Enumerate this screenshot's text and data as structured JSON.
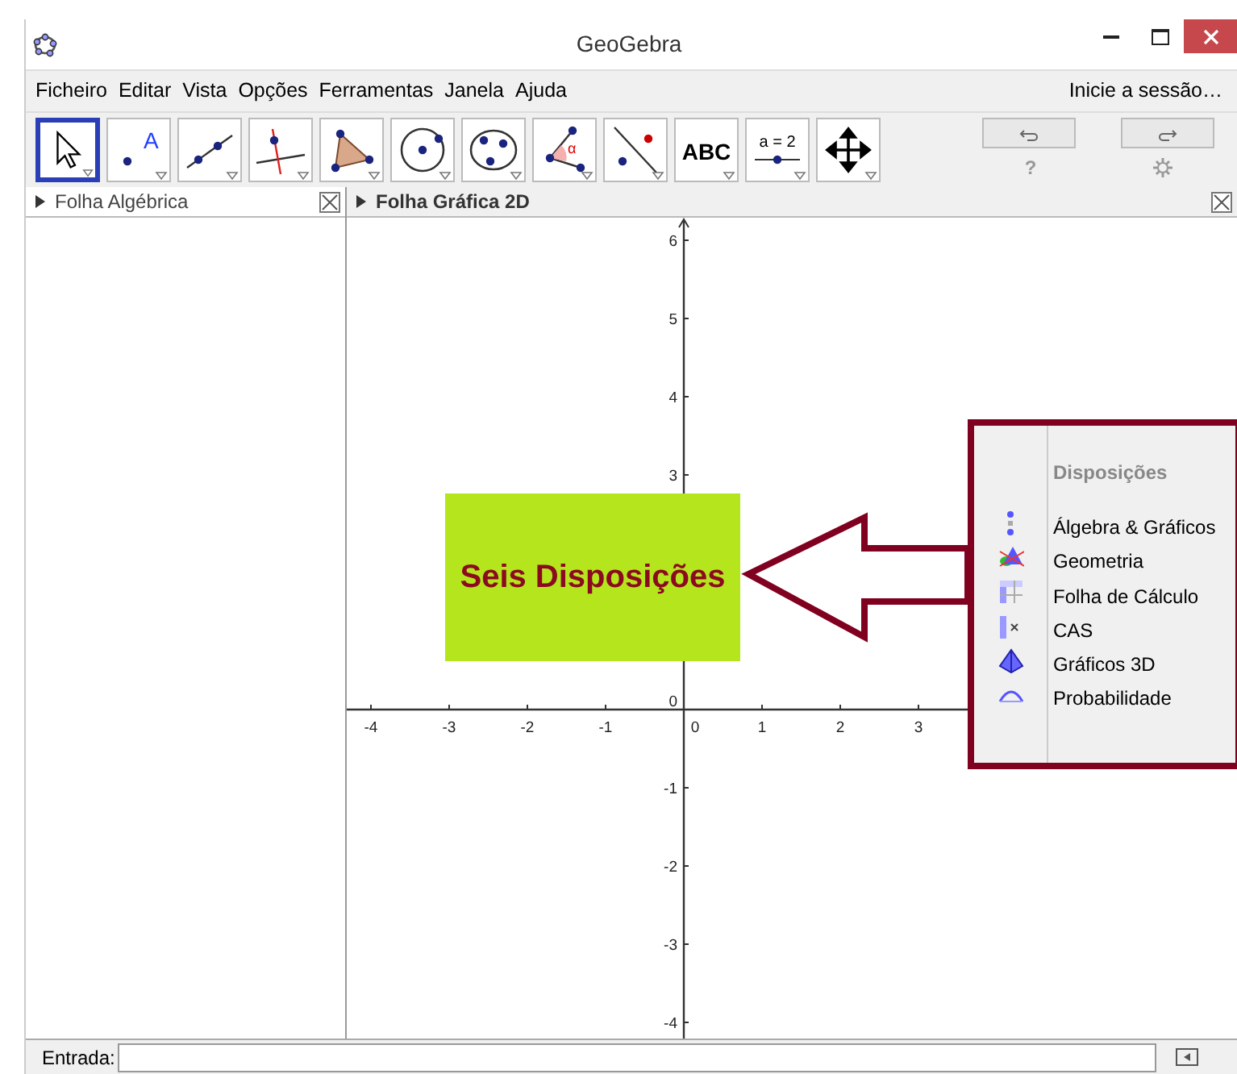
{
  "window": {
    "title": "GeoGebra"
  },
  "menu": [
    "Ficheiro",
    "Editar",
    "Vista",
    "Opções",
    "Ferramentas",
    "Janela",
    "Ajuda"
  ],
  "login": "Inicie a sessão…",
  "toolbar": [
    {
      "kind": "move",
      "selected": true
    },
    {
      "kind": "point",
      "label": "A",
      "selected": false
    },
    {
      "kind": "line",
      "selected": false
    },
    {
      "kind": "perpendicular",
      "selected": false
    },
    {
      "kind": "polygon",
      "selected": false
    },
    {
      "kind": "circle",
      "selected": false
    },
    {
      "kind": "conic",
      "selected": false
    },
    {
      "kind": "angle",
      "label": "α",
      "selected": false
    },
    {
      "kind": "reflect",
      "selected": false
    },
    {
      "kind": "text",
      "label": "ABC",
      "selected": false
    },
    {
      "kind": "slider",
      "label": "a = 2",
      "selected": false
    },
    {
      "kind": "move-view",
      "selected": false
    }
  ],
  "help": "?",
  "algebra_view": {
    "title": "Folha Algébrica"
  },
  "graphics_view": {
    "title": "Folha Gráfica 2D",
    "x_axis_labels": [
      "-4",
      "-3",
      "-2",
      "-1",
      "0",
      "1",
      "2",
      "3"
    ],
    "y_axis_labels": [
      "6",
      "5",
      "4",
      "3",
      "0",
      "-1",
      "-2",
      "-3",
      "-4"
    ],
    "callout": "Seis Disposições"
  },
  "layouts_menu": {
    "title": "Disposições",
    "items": [
      {
        "kind": "algebra-graphics",
        "label": "Álgebra & Gráficos"
      },
      {
        "kind": "geometry",
        "label": "Geometria"
      },
      {
        "kind": "spreadsheet",
        "label": "Folha de Cálculo"
      },
      {
        "kind": "cas",
        "label": "CAS"
      },
      {
        "kind": "solid",
        "label": "Gráficos 3D"
      },
      {
        "kind": "probability",
        "label": "Probabilidade"
      }
    ]
  },
  "input_bar": {
    "label": "Entrada:"
  }
}
